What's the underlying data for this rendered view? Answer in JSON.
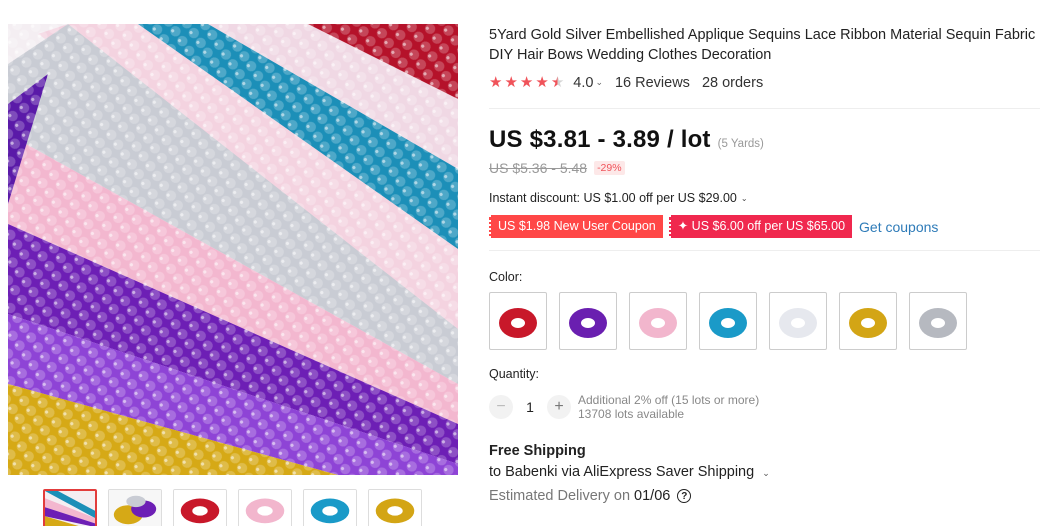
{
  "product": {
    "title": "5Yard Gold Silver Embellished Applique Sequins Lace Ribbon Material Sequin Fabric DIY Hair Bows Wedding Clothes Decoration",
    "rating": {
      "stars": 4.0,
      "value": "4.0",
      "reviews": "16 Reviews",
      "orders": "28 orders"
    },
    "price": {
      "current": "US $3.81 - 3.89 / lot",
      "unit_note": "(5 Yards)",
      "original": "US $5.36 - 5.48",
      "discount": "-29%"
    },
    "instant_discount": "Instant discount: US $1.00 off per US $29.00",
    "coupons": [
      {
        "label": "US $1.98 New User Coupon"
      },
      {
        "label": "✦ US $6.00 off per US $65.00"
      }
    ],
    "get_coupons": "Get coupons",
    "color": {
      "label": "Color:",
      "options": [
        {
          "name": "red-sequin-swatch",
          "color": "#c8182a"
        },
        {
          "name": "purple-sequin-swatch",
          "color": "#6a1fb0"
        },
        {
          "name": "pink-sequin-swatch",
          "color": "#f2b6cd"
        },
        {
          "name": "blue-sequin-swatch",
          "color": "#1a9ac8"
        },
        {
          "name": "white-sequin-swatch",
          "color": "#e6e8ee"
        },
        {
          "name": "gold-sequin-swatch",
          "color": "#d3a515"
        },
        {
          "name": "silver-sequin-swatch",
          "color": "#b6b9c0"
        }
      ]
    },
    "quantity": {
      "label": "Quantity:",
      "minus": "−",
      "value": "1",
      "plus": "+",
      "additional": "Additional 2% off (15 lots or more)",
      "available": "13708 lots available"
    },
    "shipping": {
      "title": "Free Shipping",
      "destination": "to Babenki via AliExpress Saver Shipping",
      "delivery_label": "Estimated Delivery on",
      "delivery_date": "01/06",
      "help": "?"
    }
  },
  "gallery": {
    "thumbnails": [
      {
        "name": "thumbnail-multicolor",
        "color": "#e04a7a"
      },
      {
        "name": "thumbnail-gold-purple",
        "color": "#c9a13a"
      },
      {
        "name": "thumbnail-red",
        "color": "#c8182a"
      },
      {
        "name": "thumbnail-pink",
        "color": "#f2b6cd"
      },
      {
        "name": "thumbnail-blue",
        "color": "#1a9ac8"
      },
      {
        "name": "thumbnail-gold",
        "color": "#d3a515"
      }
    ]
  },
  "colors": {
    "accent": "#ff4747",
    "coupon_alt": "#f0284e",
    "link": "#2e7bb8",
    "star": "#f0535a"
  }
}
